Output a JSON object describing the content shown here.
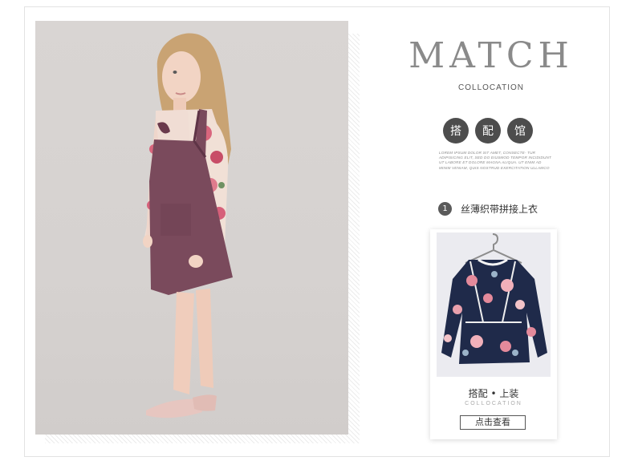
{
  "header": {
    "title": "MATCH",
    "subtitle": "COLLOCATION"
  },
  "badges": [
    "搭",
    "配",
    "馆"
  ],
  "lorem": "LOREM IPSUM DOLOR SIT AMET, CONSECTE- TUR ADIPISICING ELIT, SED DO EIUSMOD TEMPOR INCIDIDUNT UT LABORE ET DOLORE MAGNA ALIQUA. UT ENIM AD MINIM VENIAM, QUIS NOSTRUD EXERCITATION ULLAMCO",
  "item": {
    "number": "1",
    "title": "丝薄织带拼接上衣"
  },
  "card": {
    "title": "搭配 • 上装",
    "subtitle": "COLLOCATION",
    "button": "点击查看"
  },
  "colors": {
    "accent_dark": "#4d4d4d",
    "dress": "#7a4a5c",
    "floral_navy": "#1f2a4a",
    "floral_pink": "#e48a9b"
  },
  "icons": [
    "hanger-icon"
  ]
}
